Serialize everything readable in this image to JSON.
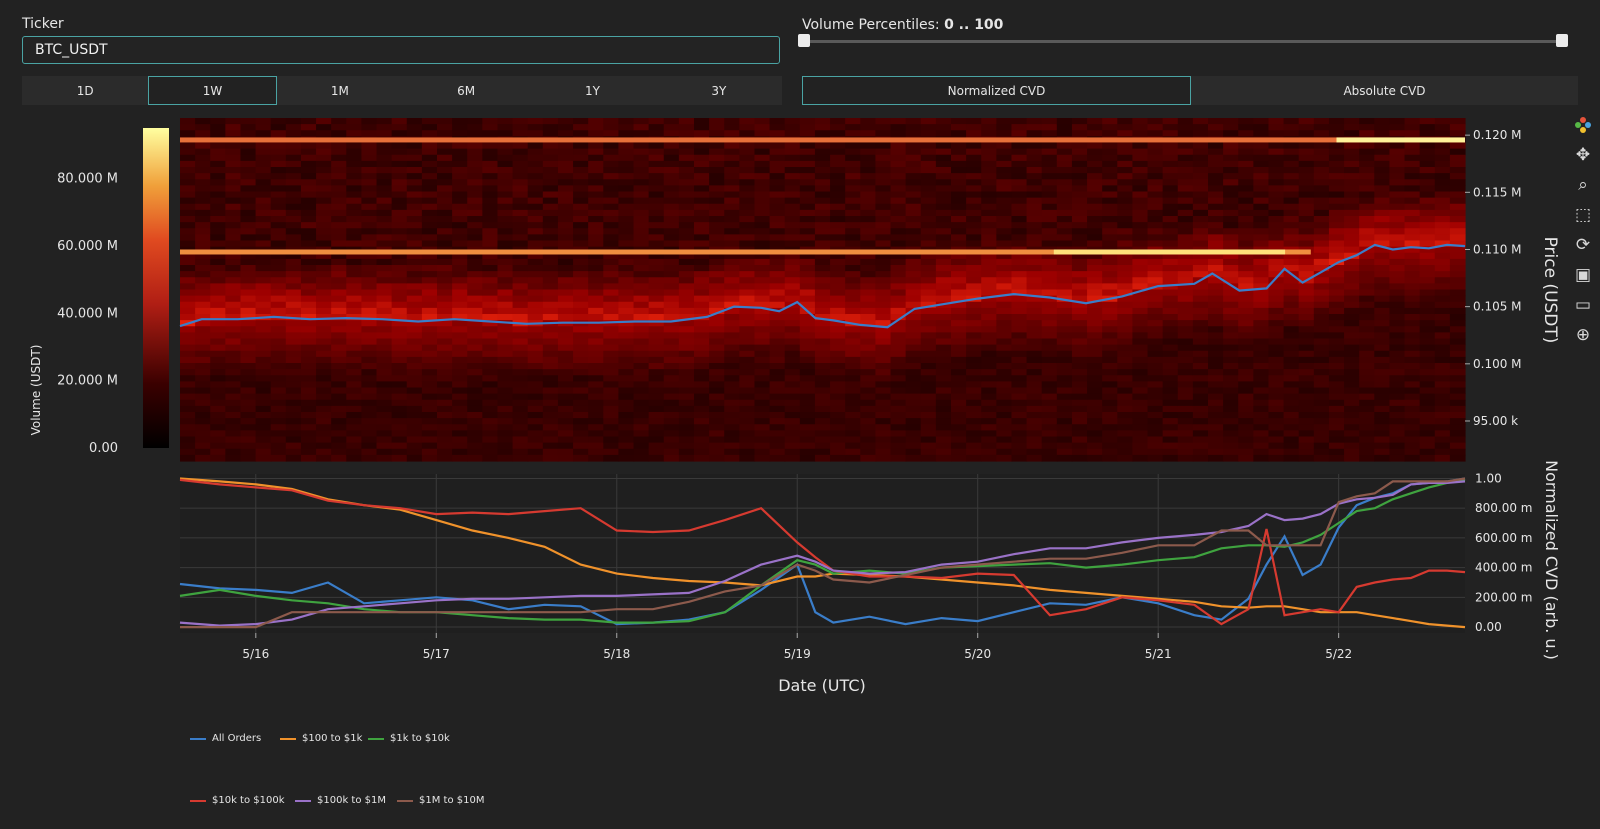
{
  "ticker": {
    "label": "Ticker",
    "value": "BTC_USDT"
  },
  "timeframes": [
    "1D",
    "1W",
    "1M",
    "6M",
    "1Y",
    "3Y"
  ],
  "timeframe_active": "1W",
  "volume_percentiles": {
    "label": "Volume Percentiles:",
    "value": "0 .. 100",
    "min": 0,
    "max": 100
  },
  "cvd_modes": [
    "Normalized CVD",
    "Absolute CVD"
  ],
  "cvd_active": "Normalized CVD",
  "toolbar_icons": [
    "plotly-logo-icon",
    "pan-icon",
    "zoom-icon",
    "box-select-icon",
    "reset-icon",
    "save-icon",
    "hover-icon",
    "spike-icon"
  ],
  "colors": {
    "All Orders": "#3a7dc9",
    "$100 to $1k": "#f0922b",
    "$1k to $10k": "#3fa33f",
    "$10k to $100k": "#d63a30",
    "$100k to $1M": "#9a72c8",
    "$1M to $10M": "#8c5a4c"
  },
  "chart_data": [
    {
      "type": "heatmap",
      "title": "",
      "xlabel": "Date (UTC)",
      "ylabel": "Price (USDT)",
      "colorbar_label": "Volume (USDT)",
      "colorbar_ticks": [
        "0.00",
        "20.000 M",
        "40.000 M",
        "60.000 M",
        "80.000 M"
      ],
      "colorbar_range": [
        0,
        95000000
      ],
      "y_ticks": [
        "95.00 k",
        "0.100 M",
        "0.105 M",
        "0.110 M",
        "0.115 M",
        "0.120 M"
      ],
      "y_range": [
        91500,
        121500
      ],
      "x_ticks": [
        "5/16",
        "5/17",
        "5/18",
        "5/19",
        "5/20",
        "5/21",
        "5/22"
      ],
      "x_range": [
        15.58,
        22.7
      ],
      "series": [
        {
          "name": "All Orders",
          "type": "line",
          "x": [
            15.58,
            15.7,
            15.9,
            16.1,
            16.3,
            16.5,
            16.7,
            16.9,
            17.1,
            17.3,
            17.5,
            17.7,
            17.9,
            18.1,
            18.3,
            18.5,
            18.65,
            18.8,
            18.9,
            19.0,
            19.1,
            19.2,
            19.35,
            19.5,
            19.65,
            19.8,
            20.0,
            20.2,
            20.4,
            20.6,
            20.8,
            21.0,
            21.2,
            21.3,
            21.45,
            21.6,
            21.7,
            21.8,
            21.9,
            22.0,
            22.1,
            22.2,
            22.3,
            22.4,
            22.5,
            22.6,
            22.7
          ],
          "values": [
            103300,
            103900,
            103900,
            104100,
            103900,
            104000,
            103900,
            103700,
            103900,
            103700,
            103500,
            103600,
            103600,
            103700,
            103700,
            104100,
            105000,
            104900,
            104600,
            105400,
            104000,
            103800,
            103400,
            103200,
            104800,
            105200,
            105700,
            106100,
            105800,
            105300,
            105900,
            106800,
            107000,
            107900,
            106400,
            106600,
            108300,
            107100,
            108000,
            108900,
            109500,
            110400,
            110000,
            110200,
            110100,
            110400,
            110300
          ]
        }
      ]
    },
    {
      "type": "line",
      "title": "",
      "xlabel": "Date (UTC)",
      "ylabel": "Normalized CVD (arb. u.)",
      "y_ticks": [
        "0.00",
        "200.00 m",
        "400.00 m",
        "600.00 m",
        "800.00 m",
        "1.00"
      ],
      "ylim": [
        -0.04,
        1.03
      ],
      "x_ticks": [
        "5/16",
        "5/17",
        "5/18",
        "5/19",
        "5/20",
        "5/21",
        "5/22"
      ],
      "x_range": [
        15.58,
        22.7
      ],
      "legend": "bottom",
      "x": [
        15.58,
        15.8,
        16.0,
        16.2,
        16.4,
        16.6,
        16.8,
        17.0,
        17.2,
        17.4,
        17.6,
        17.8,
        18.0,
        18.2,
        18.4,
        18.6,
        18.8,
        19.0,
        19.1,
        19.2,
        19.4,
        19.6,
        19.8,
        20.0,
        20.2,
        20.4,
        20.6,
        20.8,
        21.0,
        21.2,
        21.35,
        21.5,
        21.6,
        21.7,
        21.8,
        21.9,
        22.0,
        22.1,
        22.2,
        22.3,
        22.4,
        22.5,
        22.6,
        22.7
      ],
      "series": [
        {
          "name": "All Orders",
          "values": [
            0.29,
            0.26,
            0.25,
            0.23,
            0.3,
            0.16,
            0.18,
            0.2,
            0.18,
            0.12,
            0.15,
            0.14,
            0.02,
            0.03,
            0.05,
            0.1,
            0.25,
            0.42,
            0.1,
            0.03,
            0.07,
            0.02,
            0.06,
            0.04,
            0.1,
            0.16,
            0.15,
            0.2,
            0.16,
            0.08,
            0.05,
            0.19,
            0.42,
            0.61,
            0.35,
            0.42,
            0.67,
            0.82,
            0.87,
            0.9,
            0.96,
            0.97,
            0.98,
            1.0
          ]
        },
        {
          "name": "$100 to $1k",
          "values": [
            1.0,
            0.98,
            0.96,
            0.93,
            0.86,
            0.82,
            0.79,
            0.72,
            0.65,
            0.6,
            0.54,
            0.42,
            0.36,
            0.33,
            0.31,
            0.3,
            0.28,
            0.34,
            0.34,
            0.36,
            0.35,
            0.34,
            0.32,
            0.3,
            0.28,
            0.25,
            0.23,
            0.21,
            0.19,
            0.17,
            0.14,
            0.13,
            0.14,
            0.14,
            0.12,
            0.1,
            0.1,
            0.1,
            0.08,
            0.06,
            0.04,
            0.02,
            0.01,
            0.0
          ]
        },
        {
          "name": "$1k to $10k",
          "values": [
            0.21,
            0.25,
            0.21,
            0.18,
            0.16,
            0.12,
            0.1,
            0.1,
            0.08,
            0.06,
            0.05,
            0.05,
            0.03,
            0.03,
            0.04,
            0.1,
            0.28,
            0.45,
            0.42,
            0.36,
            0.38,
            0.36,
            0.4,
            0.41,
            0.42,
            0.43,
            0.4,
            0.42,
            0.45,
            0.47,
            0.53,
            0.55,
            0.55,
            0.54,
            0.57,
            0.62,
            0.7,
            0.78,
            0.8,
            0.86,
            0.9,
            0.94,
            0.97,
            0.99
          ]
        },
        {
          "name": "$10k to $100k",
          "values": [
            0.99,
            0.96,
            0.94,
            0.92,
            0.85,
            0.82,
            0.8,
            0.76,
            0.77,
            0.76,
            0.78,
            0.8,
            0.65,
            0.64,
            0.65,
            0.72,
            0.8,
            0.57,
            0.47,
            0.38,
            0.34,
            0.34,
            0.33,
            0.36,
            0.35,
            0.08,
            0.12,
            0.2,
            0.18,
            0.15,
            0.02,
            0.12,
            0.66,
            0.08,
            0.1,
            0.12,
            0.1,
            0.27,
            0.3,
            0.32,
            0.33,
            0.38,
            0.38,
            0.37
          ]
        },
        {
          "name": "$100k to $1M",
          "values": [
            0.03,
            0.01,
            0.02,
            0.05,
            0.12,
            0.14,
            0.16,
            0.18,
            0.19,
            0.19,
            0.2,
            0.21,
            0.21,
            0.22,
            0.23,
            0.31,
            0.42,
            0.48,
            0.44,
            0.38,
            0.36,
            0.37,
            0.42,
            0.44,
            0.49,
            0.53,
            0.53,
            0.57,
            0.6,
            0.62,
            0.64,
            0.68,
            0.76,
            0.72,
            0.73,
            0.76,
            0.83,
            0.86,
            0.87,
            0.89,
            0.96,
            0.97,
            0.97,
            0.98
          ]
        },
        {
          "name": "$1M to $10M",
          "values": [
            0.0,
            0.0,
            0.0,
            0.1,
            0.1,
            0.1,
            0.1,
            0.1,
            0.1,
            0.1,
            0.1,
            0.1,
            0.12,
            0.12,
            0.17,
            0.24,
            0.28,
            0.42,
            0.38,
            0.32,
            0.3,
            0.35,
            0.4,
            0.42,
            0.44,
            0.46,
            0.46,
            0.5,
            0.55,
            0.55,
            0.65,
            0.65,
            0.55,
            0.55,
            0.55,
            0.55,
            0.84,
            0.88,
            0.9,
            0.98,
            0.98,
            0.98,
            0.98,
            1.0
          ]
        }
      ]
    }
  ]
}
